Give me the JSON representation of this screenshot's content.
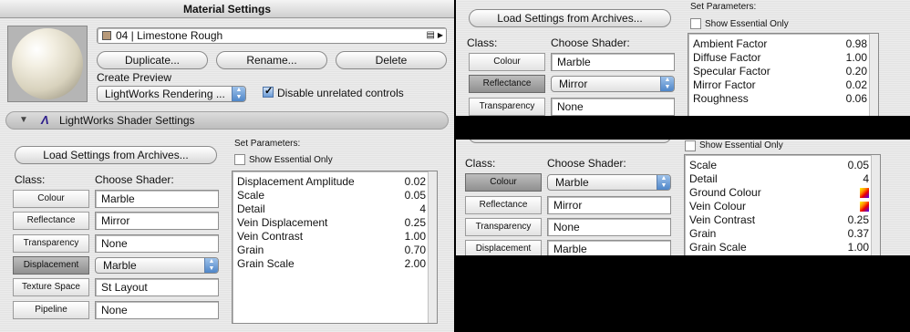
{
  "left": {
    "title": "Material Settings",
    "material_name": "04 | Limestone Rough",
    "buttons": {
      "duplicate": "Duplicate...",
      "rename": "Rename...",
      "delete": "Delete"
    },
    "create_preview_label": "Create Preview",
    "preview_renderer": "LightWorks Rendering ...",
    "disable_unrelated": "Disable unrelated controls",
    "shader_section_title": "LightWorks Shader Settings",
    "load_settings": "Load Settings from Archives...",
    "class_label": "Class:",
    "choose_shader_label": "Choose Shader:",
    "set_parameters_label": "Set Parameters:",
    "show_essential": "Show Essential Only",
    "classes": [
      {
        "label": "Colour",
        "shader": "Marble",
        "active": false
      },
      {
        "label": "Reflectance",
        "shader": "Mirror",
        "active": false
      },
      {
        "label": "Transparency",
        "shader": "None",
        "active": false
      },
      {
        "label": "Displacement",
        "shader": "Marble",
        "active": true
      },
      {
        "label": "Texture Space",
        "shader": "St Layout",
        "active": false
      },
      {
        "label": "Pipeline",
        "shader": "None",
        "active": false
      }
    ],
    "params": [
      {
        "name": "Displacement Amplitude",
        "value": "0.02"
      },
      {
        "name": "Scale",
        "value": "0.05"
      },
      {
        "name": "Detail",
        "value": "4"
      },
      {
        "name": "Vein Displacement",
        "value": "0.25"
      },
      {
        "name": "Vein Contrast",
        "value": "1.00"
      },
      {
        "name": "Grain",
        "value": "0.70"
      },
      {
        "name": "Grain Scale",
        "value": "2.00"
      }
    ]
  },
  "top_right": {
    "load_settings": "Load Settings from Archives...",
    "class_label": "Class:",
    "choose_shader_label": "Choose Shader:",
    "set_parameters_label": "Set Parameters:",
    "show_essential": "Show Essential Only",
    "classes": [
      {
        "label": "Colour",
        "shader": "Marble",
        "active": false
      },
      {
        "label": "Reflectance",
        "shader": "Mirror",
        "active": true
      },
      {
        "label": "Transparency",
        "shader": "None",
        "active": false
      }
    ],
    "params": [
      {
        "name": "Ambient Factor",
        "value": "0.98"
      },
      {
        "name": "Diffuse Factor",
        "value": "1.00"
      },
      {
        "name": "Specular Factor",
        "value": "0.20"
      },
      {
        "name": "Mirror Factor",
        "value": "0.02"
      },
      {
        "name": "Roughness",
        "value": "0.06"
      }
    ]
  },
  "bottom_right": {
    "class_label": "Class:",
    "choose_shader_label": "Choose Shader:",
    "show_essential": "Show Essential Only",
    "classes": [
      {
        "label": "Colour",
        "shader": "Marble",
        "active": true
      },
      {
        "label": "Reflectance",
        "shader": "Mirror",
        "active": false
      },
      {
        "label": "Transparency",
        "shader": "None",
        "active": false
      },
      {
        "label": "Displacement",
        "shader": "Marble",
        "active": false
      }
    ],
    "params": [
      {
        "name": "Scale",
        "value": "0.05"
      },
      {
        "name": "Detail",
        "value": "4"
      },
      {
        "name": "Ground Colour",
        "value": ""
      },
      {
        "name": "Vein Colour",
        "value": ""
      },
      {
        "name": "Vein Contrast",
        "value": "0.25"
      },
      {
        "name": "Grain",
        "value": "0.37"
      },
      {
        "name": "Grain Scale",
        "value": "1.00"
      }
    ]
  }
}
